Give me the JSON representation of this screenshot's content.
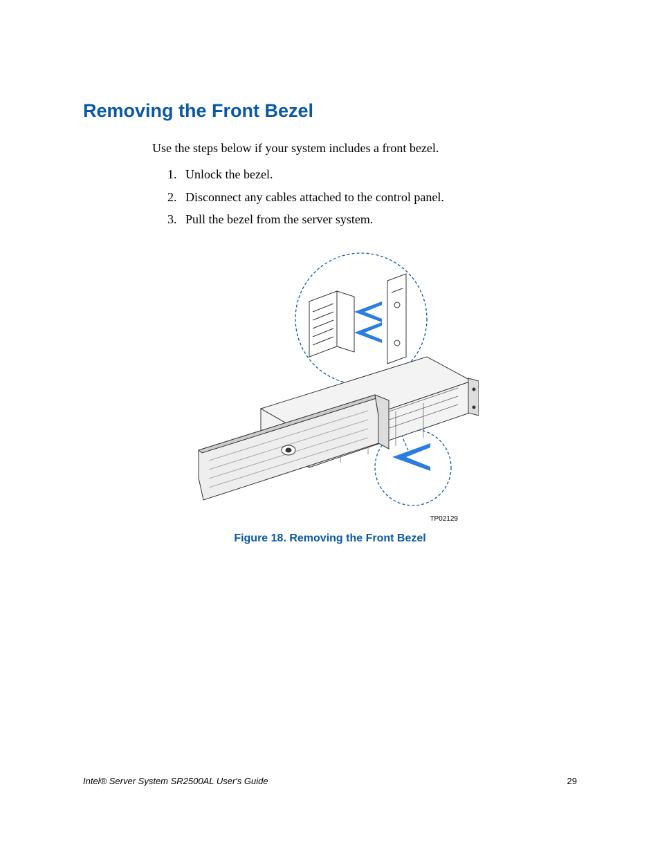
{
  "heading": "Removing the Front Bezel",
  "intro": "Use the steps below if your system includes a front bezel.",
  "steps": [
    "Unlock the bezel.",
    "Disconnect any cables attached to the control panel.",
    "Pull the bezel from the server system."
  ],
  "figure": {
    "ref": "TP02129",
    "caption": "Figure 18. Removing the Front Bezel"
  },
  "footer": {
    "title": "Intel® Server System SR2500AL User's Guide",
    "page": "29"
  }
}
